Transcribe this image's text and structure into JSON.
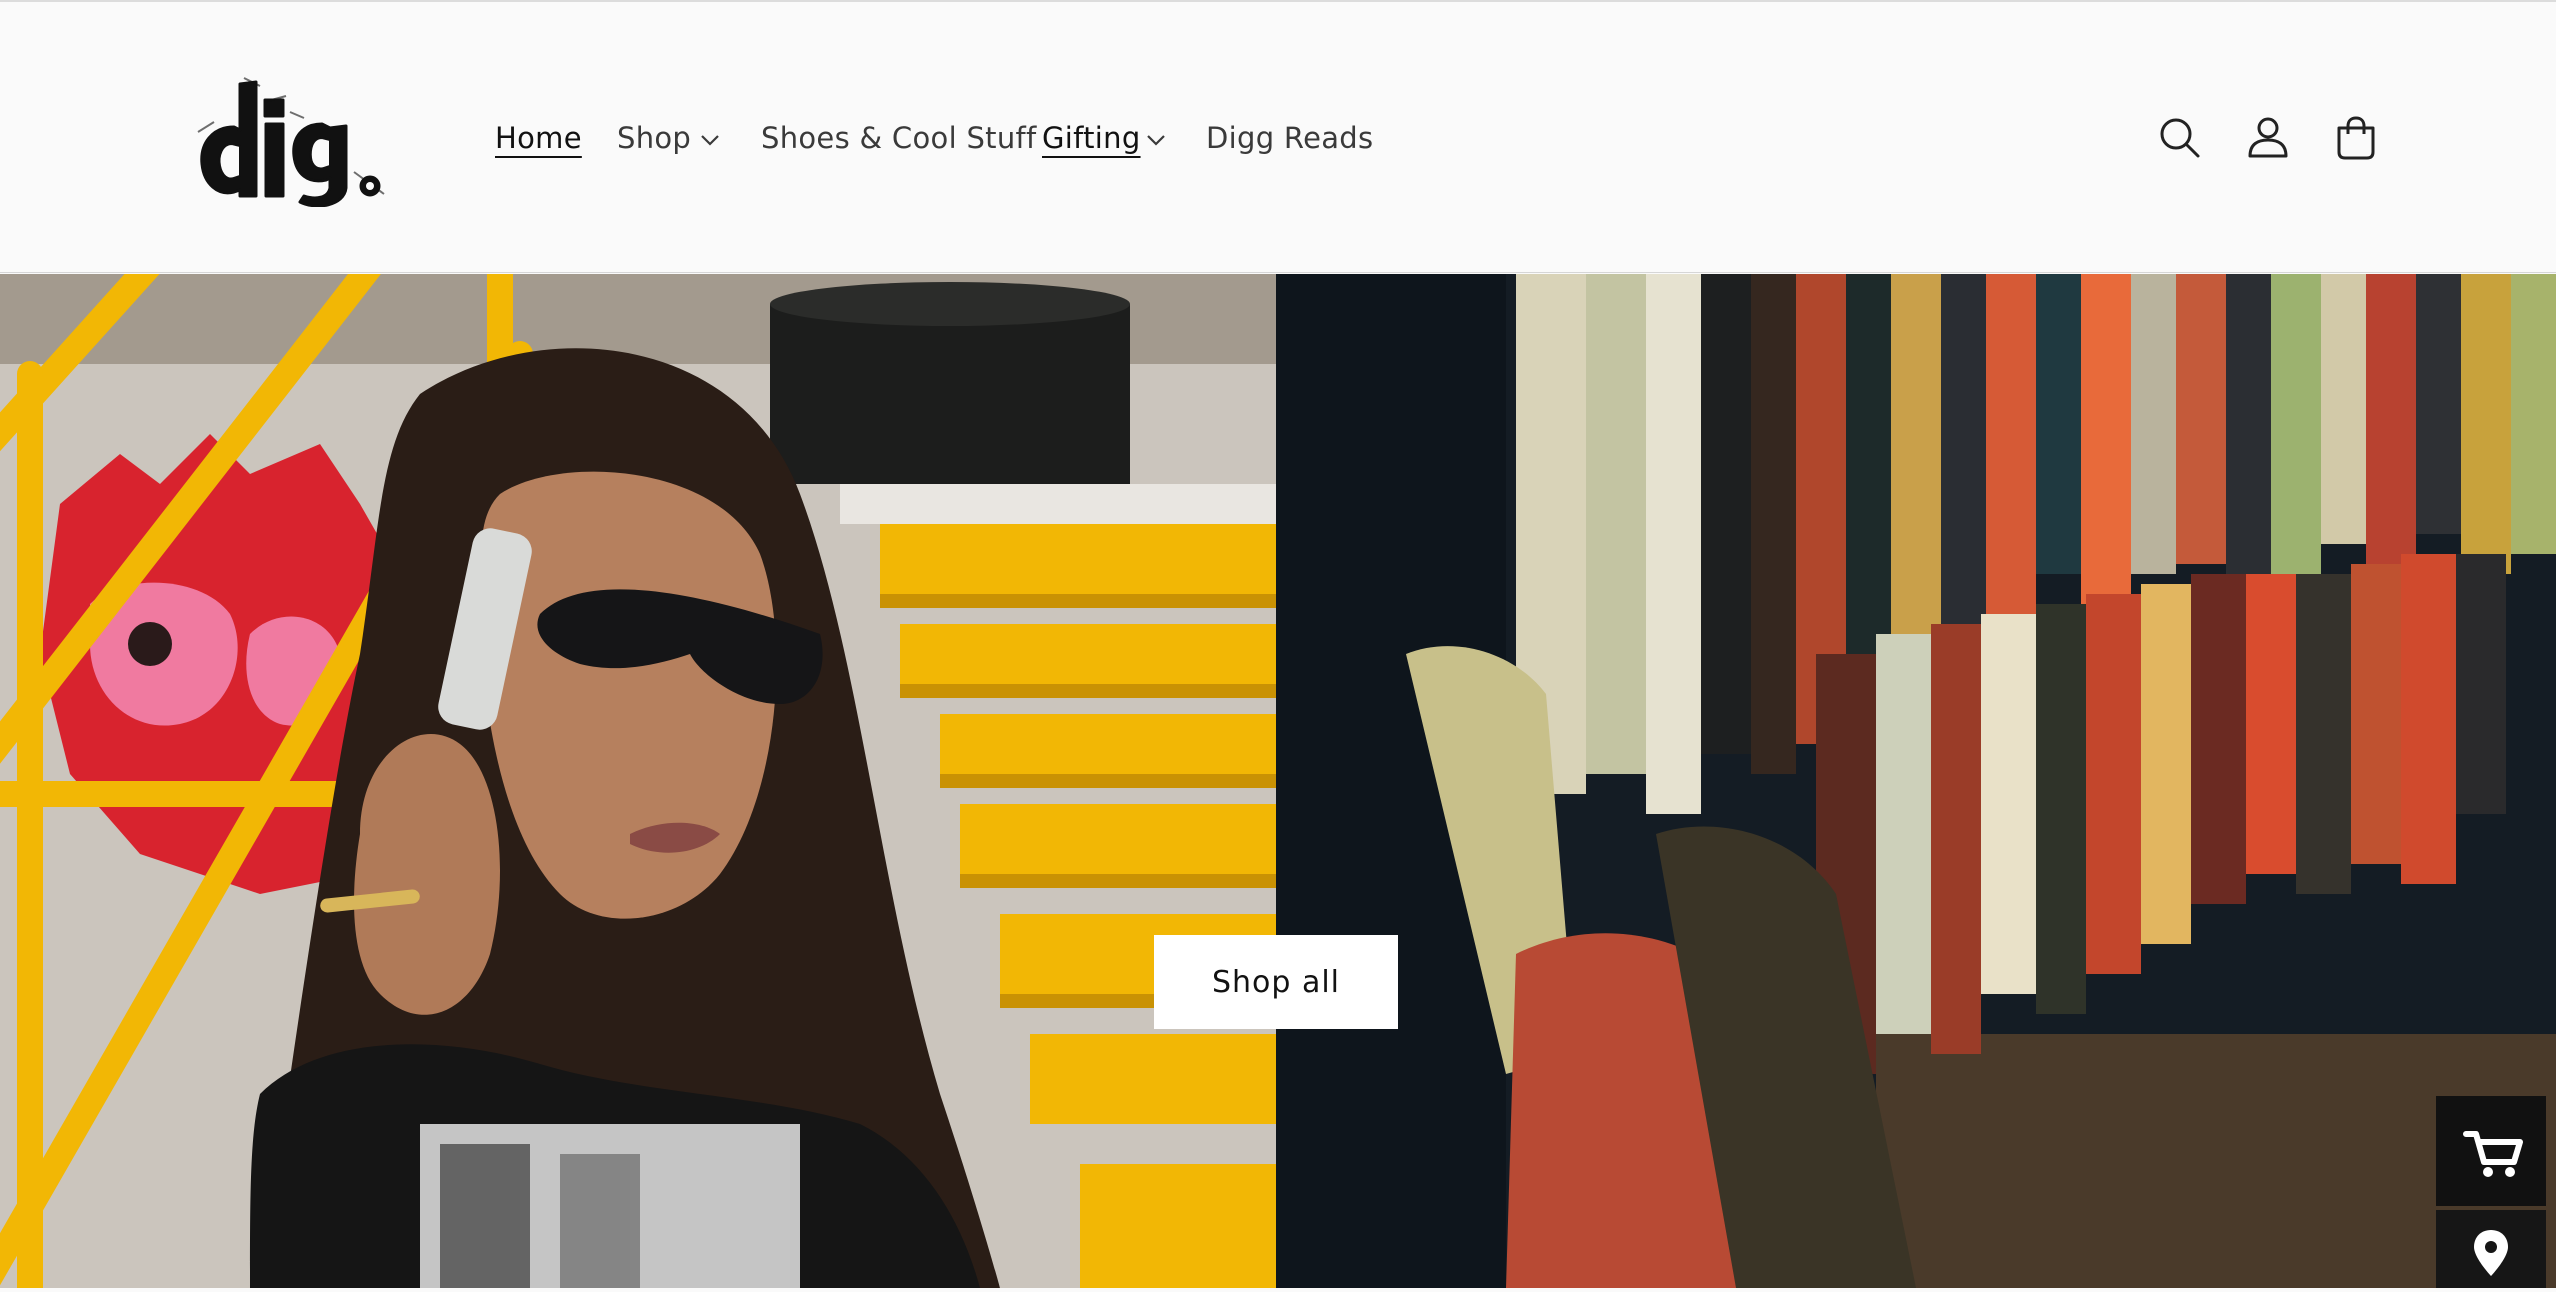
{
  "header": {
    "logo_text": "dig.",
    "nav": [
      {
        "label": "Home",
        "active": true,
        "has_dropdown": false
      },
      {
        "label": "Shop",
        "active": false,
        "has_dropdown": true
      },
      {
        "label": "Shoes & Cool Stuff",
        "active": false,
        "has_dropdown": false
      },
      {
        "label": "Gifting",
        "active": true,
        "has_dropdown": true
      },
      {
        "label": "Digg Reads",
        "active": false,
        "has_dropdown": false
      }
    ],
    "icons": [
      "search-icon",
      "account-icon",
      "cart-icon"
    ]
  },
  "hero": {
    "button_label": "Shop all",
    "left_image": "woman-on-yellow-stairs-photo",
    "right_image": "clothing-racks-photo"
  },
  "floating_widgets": [
    "cart-icon",
    "location-pin-icon"
  ],
  "colors": {
    "header_bg": "#fafafa",
    "text": "#3a3a3a",
    "button_bg": "#ffffff",
    "widget_bg": "#111111",
    "stairs_yellow": "#f2b705"
  }
}
